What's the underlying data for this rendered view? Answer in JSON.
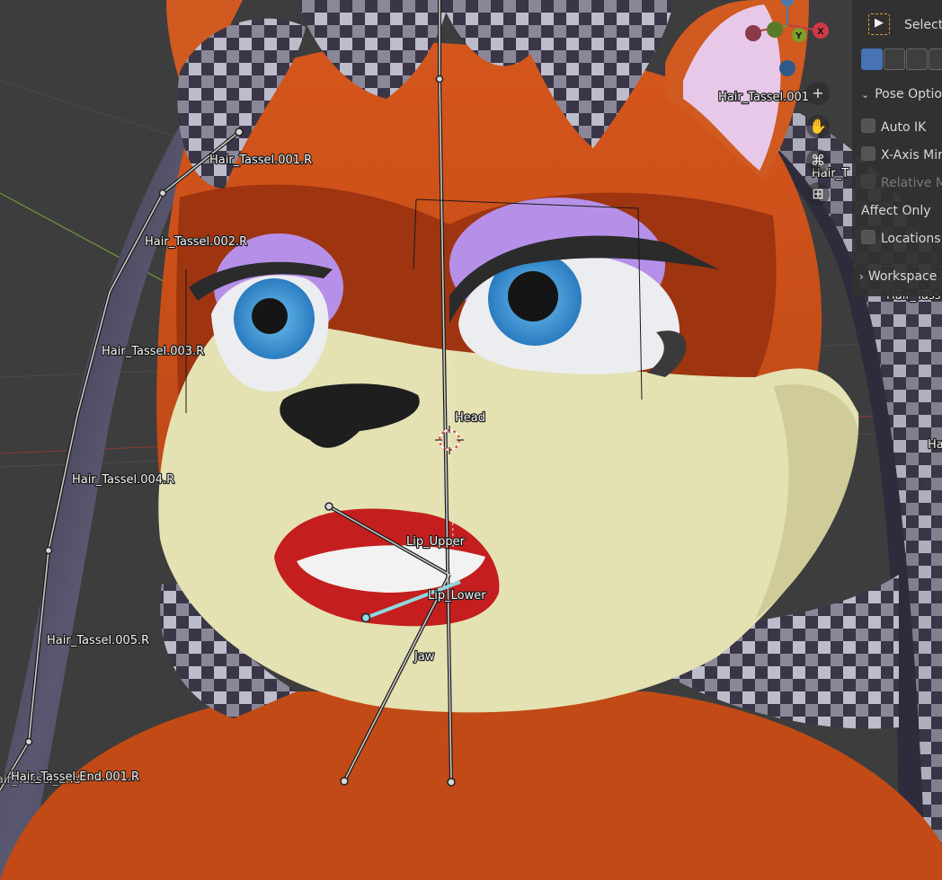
{
  "viewport": {
    "bones": {
      "tassel_001": "Hair_Tassel.001.R",
      "tassel_002": "Hair_Tassel.002.R",
      "tassel_003": "Hair_Tassel.003.R",
      "tassel_004": "Hair_Tassel.004.R",
      "tassel_005": "Hair_Tassel.005.R",
      "tassel_end": "Hair_Tassel.End.001.R",
      "tassel_end_ghost": "air_Tassel_End",
      "head": "Head",
      "lip_upper": "Lip_Upper",
      "lip_lower": "Lip_Lower",
      "jaw": "Jaw",
      "tassel_001_left": "Hair_Tassel.001",
      "tassel_partial_1": "Hair_T",
      "tassel_partial_2": "Hair_Tass",
      "tassel_partial_3": "Ha"
    },
    "gizmo": {
      "y_axis": "Y",
      "x_axis": "X"
    },
    "nav_icons": [
      "zoom-in-icon",
      "hand-pan-icon",
      "camera-icon",
      "grid-icon"
    ]
  },
  "npanel": {
    "select_label": "Select",
    "pose_options": "Pose Options",
    "auto_ik": "Auto IK",
    "x_axis_mirror": "X-Axis Mirror",
    "relative_mirror": "Relative Mirror",
    "affect_only": "Affect Only",
    "locations": "Locations",
    "workspace": "Workspace"
  },
  "colors": {
    "viewport_bg": "#3d3d3d",
    "fur_orange": "#c8501a",
    "muzzle_cream": "#e4e2b2",
    "eye_blue": "#3c96d6",
    "eyeshadow_purple": "#b690e8",
    "hair_dark": "#3a3648",
    "bone_selected": "#8fd8e0"
  }
}
